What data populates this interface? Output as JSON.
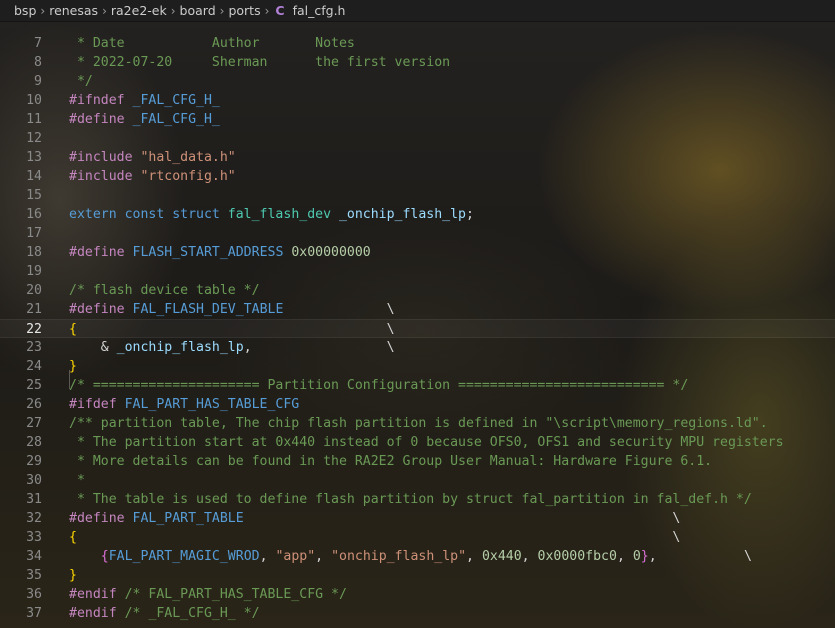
{
  "breadcrumb": {
    "items": [
      "bsp",
      "renesas",
      "ra2e2-ek",
      "board",
      "ports"
    ],
    "file_icon": "C",
    "file_name": "fal_cfg.h"
  },
  "editor": {
    "active_line": "22",
    "lines": [
      {
        "num": "7",
        "tokens": [
          {
            "t": "cm",
            "v": " * Date           Author       Notes"
          }
        ]
      },
      {
        "num": "8",
        "tokens": [
          {
            "t": "cm",
            "v": " * 2022-07-20     Sherman      the first version"
          }
        ]
      },
      {
        "num": "9",
        "tokens": [
          {
            "t": "cm",
            "v": " */"
          }
        ]
      },
      {
        "num": "10",
        "tokens": [
          {
            "t": "pp",
            "v": "#ifndef "
          },
          {
            "t": "mac",
            "v": "_FAL_CFG_H_"
          }
        ]
      },
      {
        "num": "11",
        "tokens": [
          {
            "t": "pp",
            "v": "#define "
          },
          {
            "t": "mac",
            "v": "_FAL_CFG_H_"
          }
        ]
      },
      {
        "num": "12",
        "tokens": []
      },
      {
        "num": "13",
        "tokens": [
          {
            "t": "pp",
            "v": "#include "
          },
          {
            "t": "str",
            "v": "\"hal_data.h\""
          }
        ]
      },
      {
        "num": "14",
        "tokens": [
          {
            "t": "pp",
            "v": "#include "
          },
          {
            "t": "str",
            "v": "\"rtconfig.h\""
          }
        ]
      },
      {
        "num": "15",
        "tokens": []
      },
      {
        "num": "16",
        "tokens": [
          {
            "t": "kw",
            "v": "extern "
          },
          {
            "t": "kw",
            "v": "const "
          },
          {
            "t": "kw",
            "v": "struct "
          },
          {
            "t": "ty",
            "v": "fal_flash_dev"
          },
          {
            "t": "op",
            "v": " "
          },
          {
            "t": "var",
            "v": "_onchip_flash_lp"
          },
          {
            "t": "op",
            "v": ";"
          }
        ]
      },
      {
        "num": "17",
        "tokens": []
      },
      {
        "num": "18",
        "tokens": [
          {
            "t": "pp",
            "v": "#define "
          },
          {
            "t": "mac",
            "v": "FLASH_START_ADDRESS"
          },
          {
            "t": "op",
            "v": " "
          },
          {
            "t": "num",
            "v": "0x00000000"
          }
        ]
      },
      {
        "num": "19",
        "tokens": []
      },
      {
        "num": "20",
        "tokens": [
          {
            "t": "cm",
            "v": "/* flash device table */"
          }
        ]
      },
      {
        "num": "21",
        "tokens": [
          {
            "t": "pp",
            "v": "#define "
          },
          {
            "t": "mac",
            "v": "FAL_FLASH_DEV_TABLE"
          },
          {
            "t": "op",
            "v": "             \\"
          }
        ]
      },
      {
        "num": "22",
        "tokens": [
          {
            "t": "br",
            "v": "{"
          },
          {
            "t": "op",
            "v": "                                       \\"
          }
        ]
      },
      {
        "num": "23",
        "tokens": [
          {
            "t": "op",
            "v": "    & "
          },
          {
            "t": "var",
            "v": "_onchip_flash_lp"
          },
          {
            "t": "op",
            "v": ",                 \\"
          }
        ]
      },
      {
        "num": "24",
        "tokens": [
          {
            "t": "br",
            "v": "}"
          }
        ]
      },
      {
        "num": "25",
        "tokens": [
          {
            "t": "cm",
            "v": "/* ===================== Partition Configuration ========================== */"
          }
        ]
      },
      {
        "num": "26",
        "tokens": [
          {
            "t": "pp",
            "v": "#ifdef "
          },
          {
            "t": "mac",
            "v": "FAL_PART_HAS_TABLE_CFG"
          }
        ]
      },
      {
        "num": "27",
        "tokens": [
          {
            "t": "cm",
            "v": "/** partition table, The chip flash partition is defined in \"\\script\\memory_regions.ld\"."
          }
        ]
      },
      {
        "num": "28",
        "tokens": [
          {
            "t": "cm",
            "v": " * The partition start at 0x440 instead of 0 because OFS0, OFS1 and security MPU registers"
          }
        ]
      },
      {
        "num": "29",
        "tokens": [
          {
            "t": "cm",
            "v": " * More details can be found in the RA2E2 Group User Manual: Hardware Figure 6.1."
          }
        ]
      },
      {
        "num": "30",
        "tokens": [
          {
            "t": "cm",
            "v": " *"
          }
        ]
      },
      {
        "num": "31",
        "tokens": [
          {
            "t": "cm",
            "v": " * The table is used to define flash partition by struct fal_partition in fal_def.h */"
          }
        ]
      },
      {
        "num": "32",
        "tokens": [
          {
            "t": "pp",
            "v": "#define "
          },
          {
            "t": "mac",
            "v": "FAL_PART_TABLE"
          },
          {
            "t": "op",
            "v": "                                                      \\"
          }
        ]
      },
      {
        "num": "33",
        "tokens": [
          {
            "t": "br",
            "v": "{"
          },
          {
            "t": "op",
            "v": "                                                                           \\"
          }
        ]
      },
      {
        "num": "34",
        "tokens": [
          {
            "t": "op",
            "v": "    "
          },
          {
            "t": "br2",
            "v": "{"
          },
          {
            "t": "mac",
            "v": "FAL_PART_MAGIC_WROD"
          },
          {
            "t": "op",
            "v": ", "
          },
          {
            "t": "str",
            "v": "\"app\""
          },
          {
            "t": "op",
            "v": ", "
          },
          {
            "t": "str",
            "v": "\"onchip_flash_lp\""
          },
          {
            "t": "op",
            "v": ", "
          },
          {
            "t": "num",
            "v": "0x440"
          },
          {
            "t": "op",
            "v": ", "
          },
          {
            "t": "num",
            "v": "0x0000fbc0"
          },
          {
            "t": "op",
            "v": ", "
          },
          {
            "t": "num",
            "v": "0"
          },
          {
            "t": "br2",
            "v": "}"
          },
          {
            "t": "op",
            "v": ",           \\"
          }
        ]
      },
      {
        "num": "35",
        "tokens": [
          {
            "t": "br",
            "v": "}"
          }
        ]
      },
      {
        "num": "36",
        "tokens": [
          {
            "t": "pp",
            "v": "#endif "
          },
          {
            "t": "cm",
            "v": "/* FAL_PART_HAS_TABLE_CFG */"
          }
        ]
      },
      {
        "num": "37",
        "tokens": [
          {
            "t": "pp",
            "v": "#endif "
          },
          {
            "t": "cm",
            "v": "/* _FAL_CFG_H_ */"
          }
        ]
      }
    ]
  }
}
